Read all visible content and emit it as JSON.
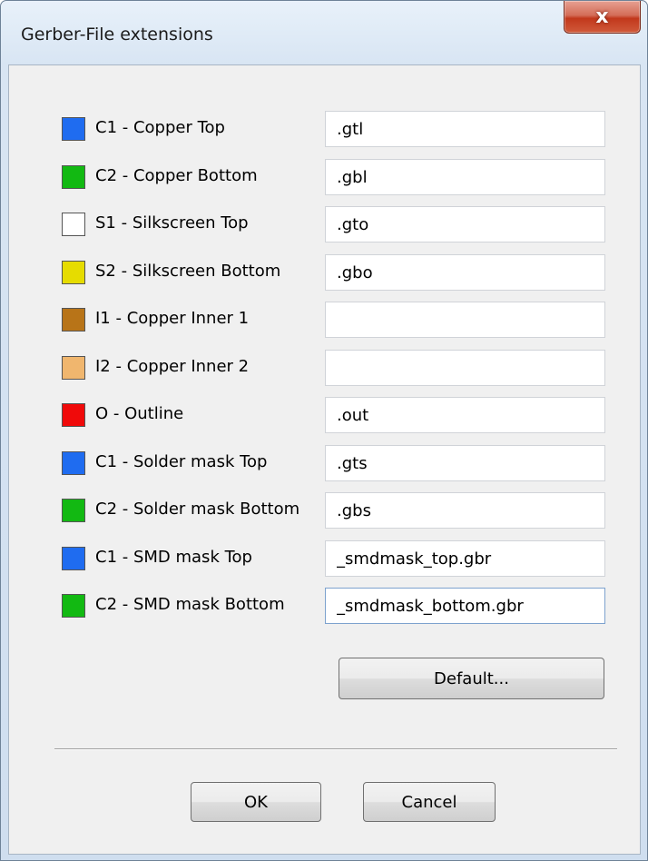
{
  "window": {
    "title": "Gerber-File extensions",
    "close_glyph": "x"
  },
  "layers": [
    {
      "label": "C1 - Copper Top",
      "color": "#1f6cf0",
      "value": ".gtl"
    },
    {
      "label": "C2 - Copper Bottom",
      "color": "#12b912",
      "value": ".gbl"
    },
    {
      "label": "S1 - Silkscreen Top",
      "color": "#ffffff",
      "value": ".gto"
    },
    {
      "label": "S2 - Silkscreen Bottom",
      "color": "#e6dc00",
      "value": ".gbo"
    },
    {
      "label": "I1 - Copper Inner 1",
      "color": "#b87418",
      "value": ""
    },
    {
      "label": "I2 - Copper Inner 2",
      "color": "#f0b66e",
      "value": ""
    },
    {
      "label": "O - Outline",
      "color": "#f00a0a",
      "value": ".out"
    },
    {
      "label": "C1 - Solder mask Top",
      "color": "#1f6cf0",
      "value": ".gts"
    },
    {
      "label": "C2 - Solder mask Bottom",
      "color": "#12b912",
      "value": ".gbs"
    },
    {
      "label": "C1 - SMD mask Top",
      "color": "#1f6cf0",
      "value": "_smdmask_top.gbr"
    },
    {
      "label": "C2 - SMD mask Bottom",
      "color": "#12b912",
      "value": "_smdmask_bottom.gbr"
    }
  ],
  "buttons": {
    "default_label": "Default...",
    "ok_label": "OK",
    "cancel_label": "Cancel"
  }
}
